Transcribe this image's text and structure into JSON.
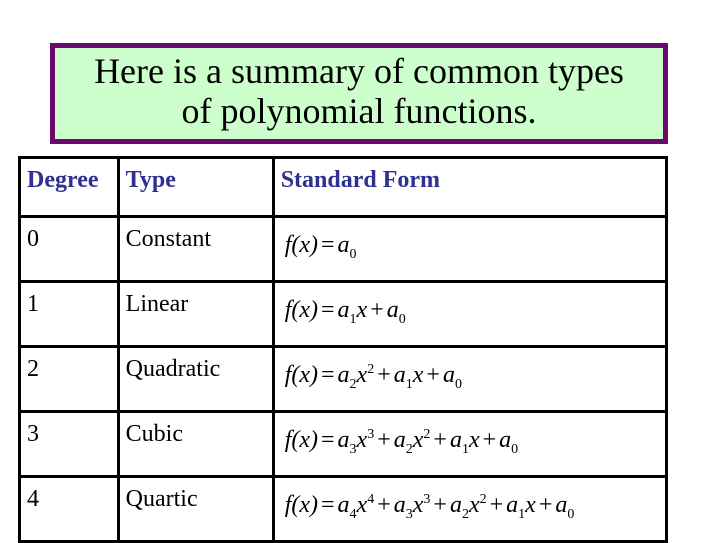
{
  "title": {
    "line1": "Here is a summary of common types",
    "line2": "of polynomial functions."
  },
  "colors": {
    "title_bg": "#ccffcc",
    "title_border": "#6a0a6e",
    "header_text": "#2e3192",
    "formula_text": "#c0161e"
  },
  "table": {
    "headers": [
      "Degree",
      "Type",
      "Standard Form"
    ],
    "rows": [
      {
        "degree": "0",
        "type": "Constant",
        "formula": "f(x) = a₀",
        "terms": [
          {
            "coef": "a",
            "sub": "0",
            "pow": ""
          }
        ]
      },
      {
        "degree": "1",
        "type": "Linear",
        "formula": "f(x) = a₁x + a₀",
        "terms": [
          {
            "coef": "a",
            "sub": "1",
            "pow": "1"
          },
          {
            "coef": "a",
            "sub": "0",
            "pow": ""
          }
        ]
      },
      {
        "degree": "2",
        "type": "Quadratic",
        "formula": "f(x) = a₂x² + a₁x + a₀",
        "terms": [
          {
            "coef": "a",
            "sub": "2",
            "pow": "2"
          },
          {
            "coef": "a",
            "sub": "1",
            "pow": "1"
          },
          {
            "coef": "a",
            "sub": "0",
            "pow": ""
          }
        ]
      },
      {
        "degree": "3",
        "type": "Cubic",
        "formula": "f(x) = a₃x³ + a₂x² + a₁x + a₀",
        "terms": [
          {
            "coef": "a",
            "sub": "3",
            "pow": "3"
          },
          {
            "coef": "a",
            "sub": "2",
            "pow": "2"
          },
          {
            "coef": "a",
            "sub": "1",
            "pow": "1"
          },
          {
            "coef": "a",
            "sub": "0",
            "pow": ""
          }
        ]
      },
      {
        "degree": "4",
        "type": "Quartic",
        "formula": "f(x) = a₄x⁴ + a₃x³ + a₂x² + a₁x + a₀",
        "terms": [
          {
            "coef": "a",
            "sub": "4",
            "pow": "4"
          },
          {
            "coef": "a",
            "sub": "3",
            "pow": "3"
          },
          {
            "coef": "a",
            "sub": "2",
            "pow": "2"
          },
          {
            "coef": "a",
            "sub": "1",
            "pow": "1"
          },
          {
            "coef": "a",
            "sub": "0",
            "pow": ""
          }
        ]
      }
    ],
    "lhs": "f(x)",
    "eq": "=",
    "plus": "+",
    "var": "x"
  }
}
